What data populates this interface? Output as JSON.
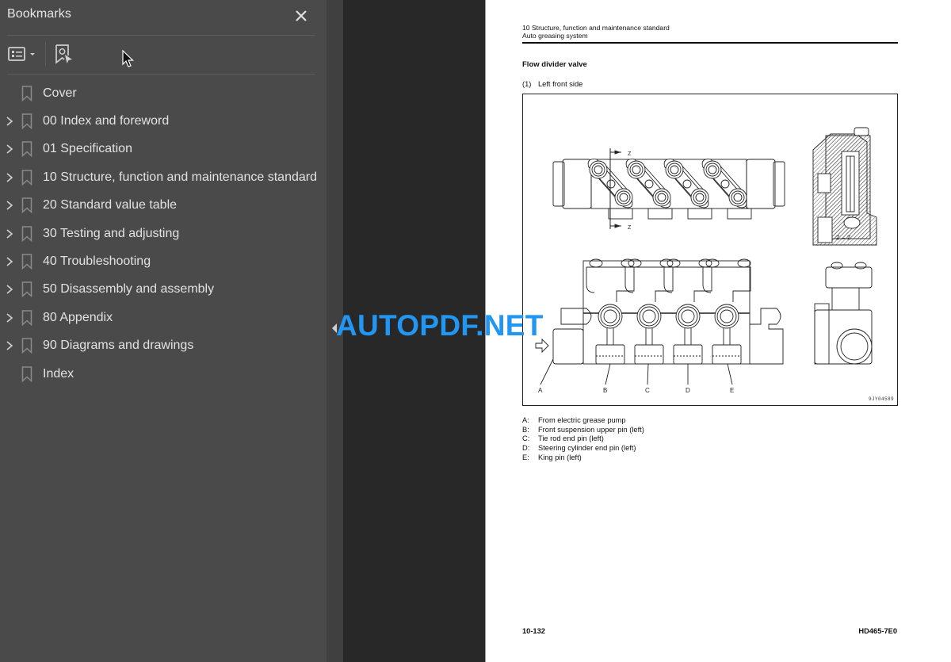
{
  "sidebar": {
    "title": "Bookmarks",
    "close_icon": "close-icon",
    "toolbar": {
      "options_icon": "list-options-icon",
      "find_icon": "find-current-bookmark-icon"
    },
    "items": [
      {
        "label": "Cover",
        "expandable": false
      },
      {
        "label": "00 Index and foreword",
        "expandable": true
      },
      {
        "label": "01 Specification",
        "expandable": true
      },
      {
        "label": "10 Structure, function and maintenance standard",
        "expandable": true
      },
      {
        "label": "20 Standard value table",
        "expandable": true
      },
      {
        "label": "30 Testing and adjusting",
        "expandable": true
      },
      {
        "label": "40 Troubleshooting",
        "expandable": true
      },
      {
        "label": "50 Disassembly and assembly",
        "expandable": true
      },
      {
        "label": "80 Appendix",
        "expandable": true
      },
      {
        "label": "90 Diagrams and drawings",
        "expandable": true
      },
      {
        "label": "Index",
        "expandable": false
      }
    ]
  },
  "page": {
    "header_line1": "10 Structure, function and maintenance standard",
    "header_line2": "Auto greasing system",
    "section_title": "Flow divider valve",
    "subsection_num": "(1)",
    "subsection_title": "Left front side",
    "figure": {
      "section_marker": "Z",
      "section_caption": "Z – Z",
      "callouts": [
        "A",
        "B",
        "C",
        "D",
        "E"
      ],
      "code": "9JY04589"
    },
    "legend": [
      {
        "key": "A:",
        "text": "From electric grease pump"
      },
      {
        "key": "B:",
        "text": "Front suspension upper pin (left)"
      },
      {
        "key": "C:",
        "text": "Tie rod end pin (left)"
      },
      {
        "key": "D:",
        "text": "Steering cylinder end pin (left)"
      },
      {
        "key": "E:",
        "text": "King pin (left)"
      }
    ],
    "footer_page": "10-132",
    "footer_model": "HD465-7E0"
  },
  "watermark": "AUTOPDF.NET",
  "colors": {
    "sidebar_bg": "#4a4a4a",
    "viewer_bg": "#282828",
    "watermark": "#2196f3"
  }
}
